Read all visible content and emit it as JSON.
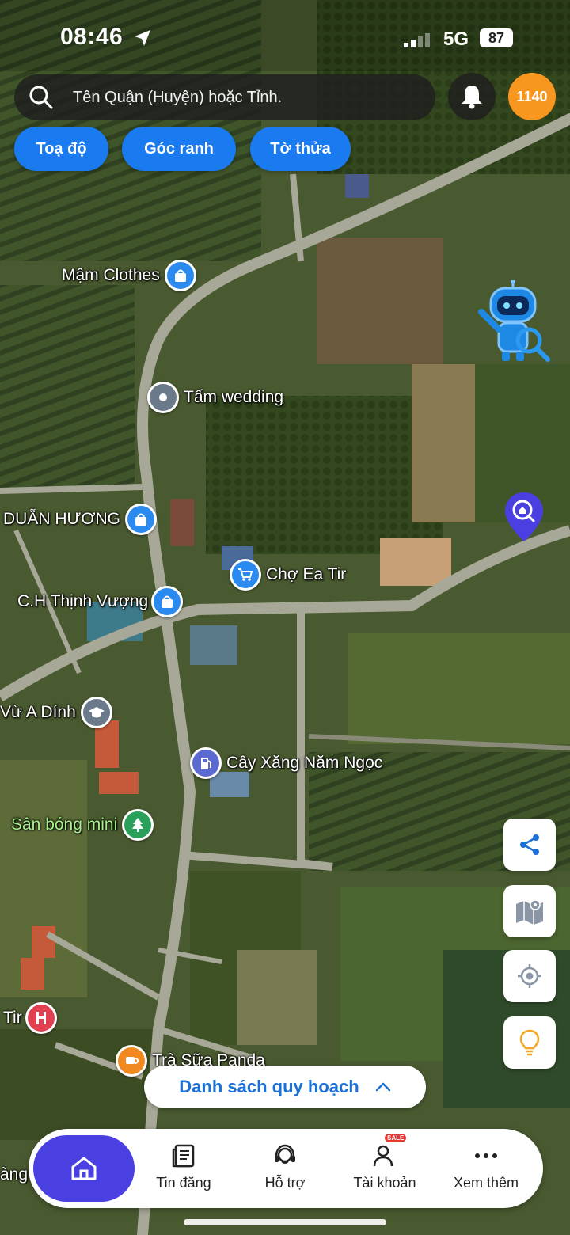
{
  "status_bar": {
    "time": "08:46",
    "network": "5G",
    "battery": "87"
  },
  "search": {
    "placeholder": "Tên Quận (Huyện) hoặc Tỉnh."
  },
  "points_badge": "1140",
  "chips": [
    {
      "label": "Toạ độ"
    },
    {
      "label": "Góc ranh"
    },
    {
      "label": "Tờ thửa"
    }
  ],
  "map_places": [
    {
      "label": "Mậm Clothes",
      "icon": "shopping-bag-icon"
    },
    {
      "label": "Tấm wedding",
      "icon": "place-icon"
    },
    {
      "label": "DUẪN HƯƠNG",
      "icon": "shopping-bag-icon"
    },
    {
      "label": "Chợ Ea Tir",
      "icon": "shopping-cart-icon"
    },
    {
      "label": "C.H Thịnh Vượng",
      "icon": "shopping-bag-icon"
    },
    {
      "label": "Vừ A Dính",
      "icon": "graduation-cap-icon"
    },
    {
      "label": "Cây Xăng Năm Ngọc",
      "icon": "fuel-pump-icon"
    },
    {
      "label": "Sân bóng mini",
      "icon": "tree-icon"
    },
    {
      "label": "Tir",
      "icon": "hospital-icon"
    },
    {
      "label": "Trà Sữa Panda",
      "icon": "cafe-icon"
    },
    {
      "label": "àng",
      "icon": ""
    }
  ],
  "planning_list": {
    "label": "Danh sách quy hoạch"
  },
  "tabs": [
    {
      "label": "Tin đăng",
      "icon": "news-icon"
    },
    {
      "label": "Hỗ trợ",
      "icon": "support-icon"
    },
    {
      "label": "Tài khoản",
      "icon": "account-icon",
      "badge": "SALE"
    },
    {
      "label": "Xem thêm",
      "icon": "more-icon"
    }
  ],
  "colors": {
    "accent": "#1a7af0",
    "home_tab": "#4a3fe0",
    "points": "#f89720"
  }
}
